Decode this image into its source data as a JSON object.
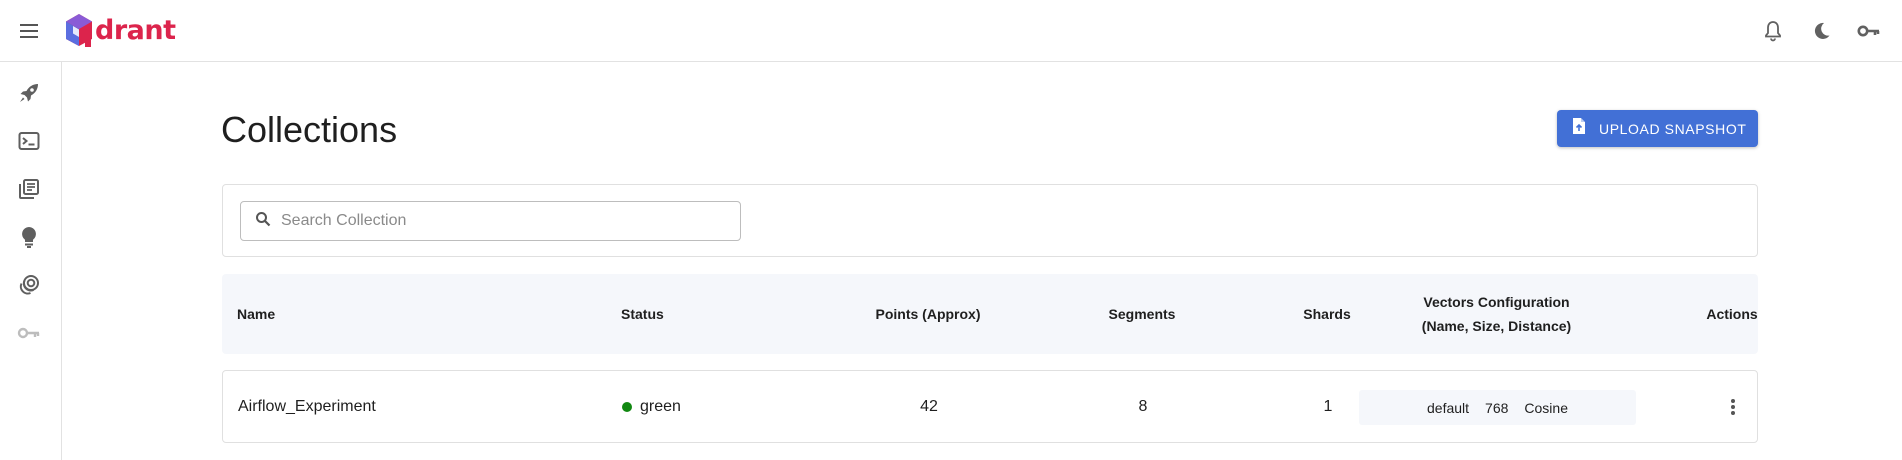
{
  "app": {
    "logo_text": "drant",
    "brand_color": "#dc244c",
    "accent_color": "#4270d6"
  },
  "topbar": {
    "menu_icon": "menu-icon",
    "icons": [
      "bell-icon",
      "moon-icon",
      "key-icon"
    ]
  },
  "sidebar": {
    "items": [
      {
        "icon": "rocket-icon"
      },
      {
        "icon": "terminal-icon"
      },
      {
        "icon": "library-icon"
      },
      {
        "icon": "lightbulb-icon"
      },
      {
        "icon": "collections-icon"
      },
      {
        "icon": "key-icon",
        "disabled": true
      }
    ]
  },
  "main": {
    "title": "Collections",
    "upload_label": "Upload Snapshot",
    "search": {
      "placeholder": "Search Collection",
      "value": ""
    },
    "table": {
      "headers": {
        "name": "Name",
        "status": "Status",
        "points": "Points (Approx)",
        "segments": "Segments",
        "shards": "Shards",
        "vectors_line1": "Vectors Configuration",
        "vectors_line2": "(Name, Size, Distance)",
        "actions": "Actions"
      },
      "rows": [
        {
          "name": "Airflow_Experiment",
          "status": "green",
          "status_color": "#118811",
          "points": "42",
          "segments": "8",
          "shards": "1",
          "vector_name": "default",
          "vector_size": "768",
          "vector_distance": "Cosine"
        }
      ]
    }
  }
}
